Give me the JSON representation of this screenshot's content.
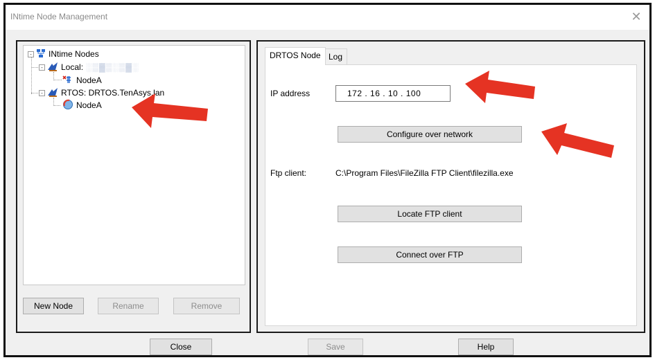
{
  "window": {
    "title": "INtime Node Management",
    "close_glyph": "✕"
  },
  "tree": {
    "root": {
      "label": "INtime Nodes",
      "expander": "-"
    },
    "local": {
      "label": "Local:",
      "expander": "-",
      "blurred_name": "░▒▓▒░▒▓░"
    },
    "local_node": {
      "label": "NodeA"
    },
    "rtos": {
      "label": "RTOS: DRTOS.TenAsys.lan",
      "expander": "-"
    },
    "rtos_node": {
      "label": "NodeA"
    }
  },
  "left_buttons": {
    "new_node": "New Node",
    "rename": "Rename",
    "remove": "Remove"
  },
  "tabs": [
    {
      "label": "DRTOS Node"
    },
    {
      "label": "Log"
    }
  ],
  "drtos": {
    "ip_label": "IP address",
    "ip_value": "172  .  16  .  10  .  100",
    "configure_button": "Configure over network",
    "ftp_label": "Ftp client:",
    "ftp_path": "C:\\Program Files\\FileZilla FTP Client\\filezilla.exe",
    "locate_button": "Locate FTP client",
    "connect_button": "Connect over FTP"
  },
  "bottom_buttons": {
    "close": "Close",
    "save": "Save",
    "help": "Help"
  },
  "colors": {
    "annotation_arrow": "#e53323"
  }
}
